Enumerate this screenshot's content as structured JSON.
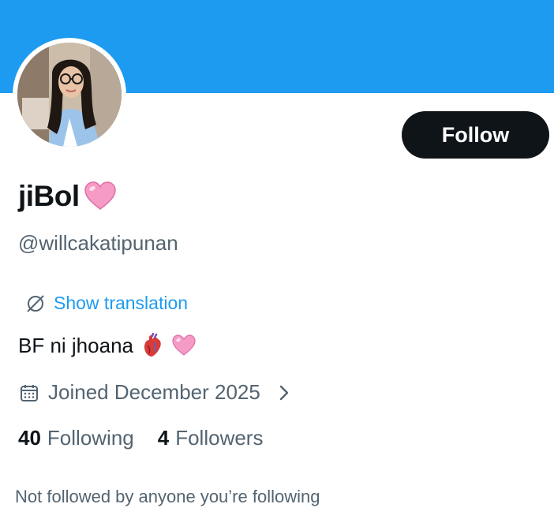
{
  "profile": {
    "display_name": "jiBol",
    "handle": "@willcakatipunan",
    "follow_label": "Follow",
    "translate_label": "Show translation",
    "bio": "BF ni jhoana",
    "joined": "Joined December 2025",
    "following_count": "40",
    "following_label": "Following",
    "followers_count": "4",
    "followers_label": "Followers",
    "not_followed_text": "Not followed by anyone you’re following"
  },
  "colors": {
    "banner": "#1d9bf0",
    "link": "#1d9bf0",
    "primary_text": "#0f1419",
    "secondary_text": "#536471",
    "follow_button": "#0f1419"
  },
  "icons": {
    "name_emoji": "pink-heart-icon",
    "translate": "translate-globe-icon",
    "bio_emoji_1": "anatomical-heart-icon",
    "bio_emoji_2": "pink-heart-icon",
    "joined": "calendar-icon",
    "joined_chevron": "chevron-right-icon"
  }
}
